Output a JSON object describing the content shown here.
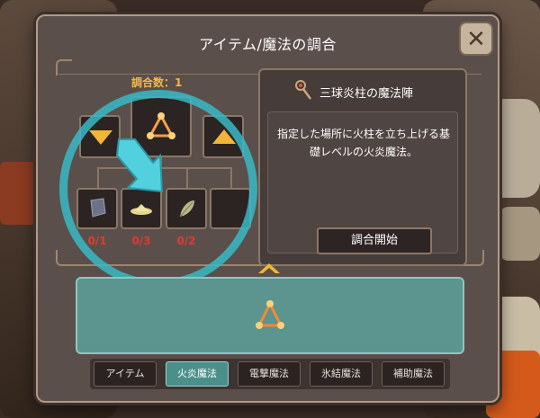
{
  "window": {
    "title": "アイテム/魔法の調合",
    "close_label": "✕"
  },
  "recipe": {
    "craft_count": "調合数：1",
    "selected_icon": "fire-triangle-icon",
    "ingredients": [
      {
        "icon": "stone-icon",
        "count": "0/1"
      },
      {
        "icon": "powder-icon",
        "count": "0/3"
      },
      {
        "icon": "leaf-icon",
        "count": "0/2"
      },
      {
        "icon": "",
        "count": ""
      }
    ]
  },
  "detail": {
    "icon": "staff-icon",
    "name": "三球炎柱の魔法陣",
    "description": "指定した場所に火柱を立ち上げる基礎レベルの火炎魔法。",
    "start_button": "調合開始"
  },
  "spell_list": {
    "items": [
      {
        "icon": "fire-triangle-icon"
      }
    ]
  },
  "tabs": [
    {
      "label": "アイテム",
      "active": false
    },
    {
      "label": "火炎魔法",
      "active": true
    },
    {
      "label": "電撃魔法",
      "active": false
    },
    {
      "label": "氷結魔法",
      "active": false
    },
    {
      "label": "補助魔法",
      "active": false
    }
  ],
  "colors": {
    "panel": "#5b4f4b",
    "accent_gold": "#f0b53a",
    "count_red": "#e23a2f",
    "tutorial_cyan": "#38b8c6",
    "active_tab": "#4a8f8a"
  }
}
